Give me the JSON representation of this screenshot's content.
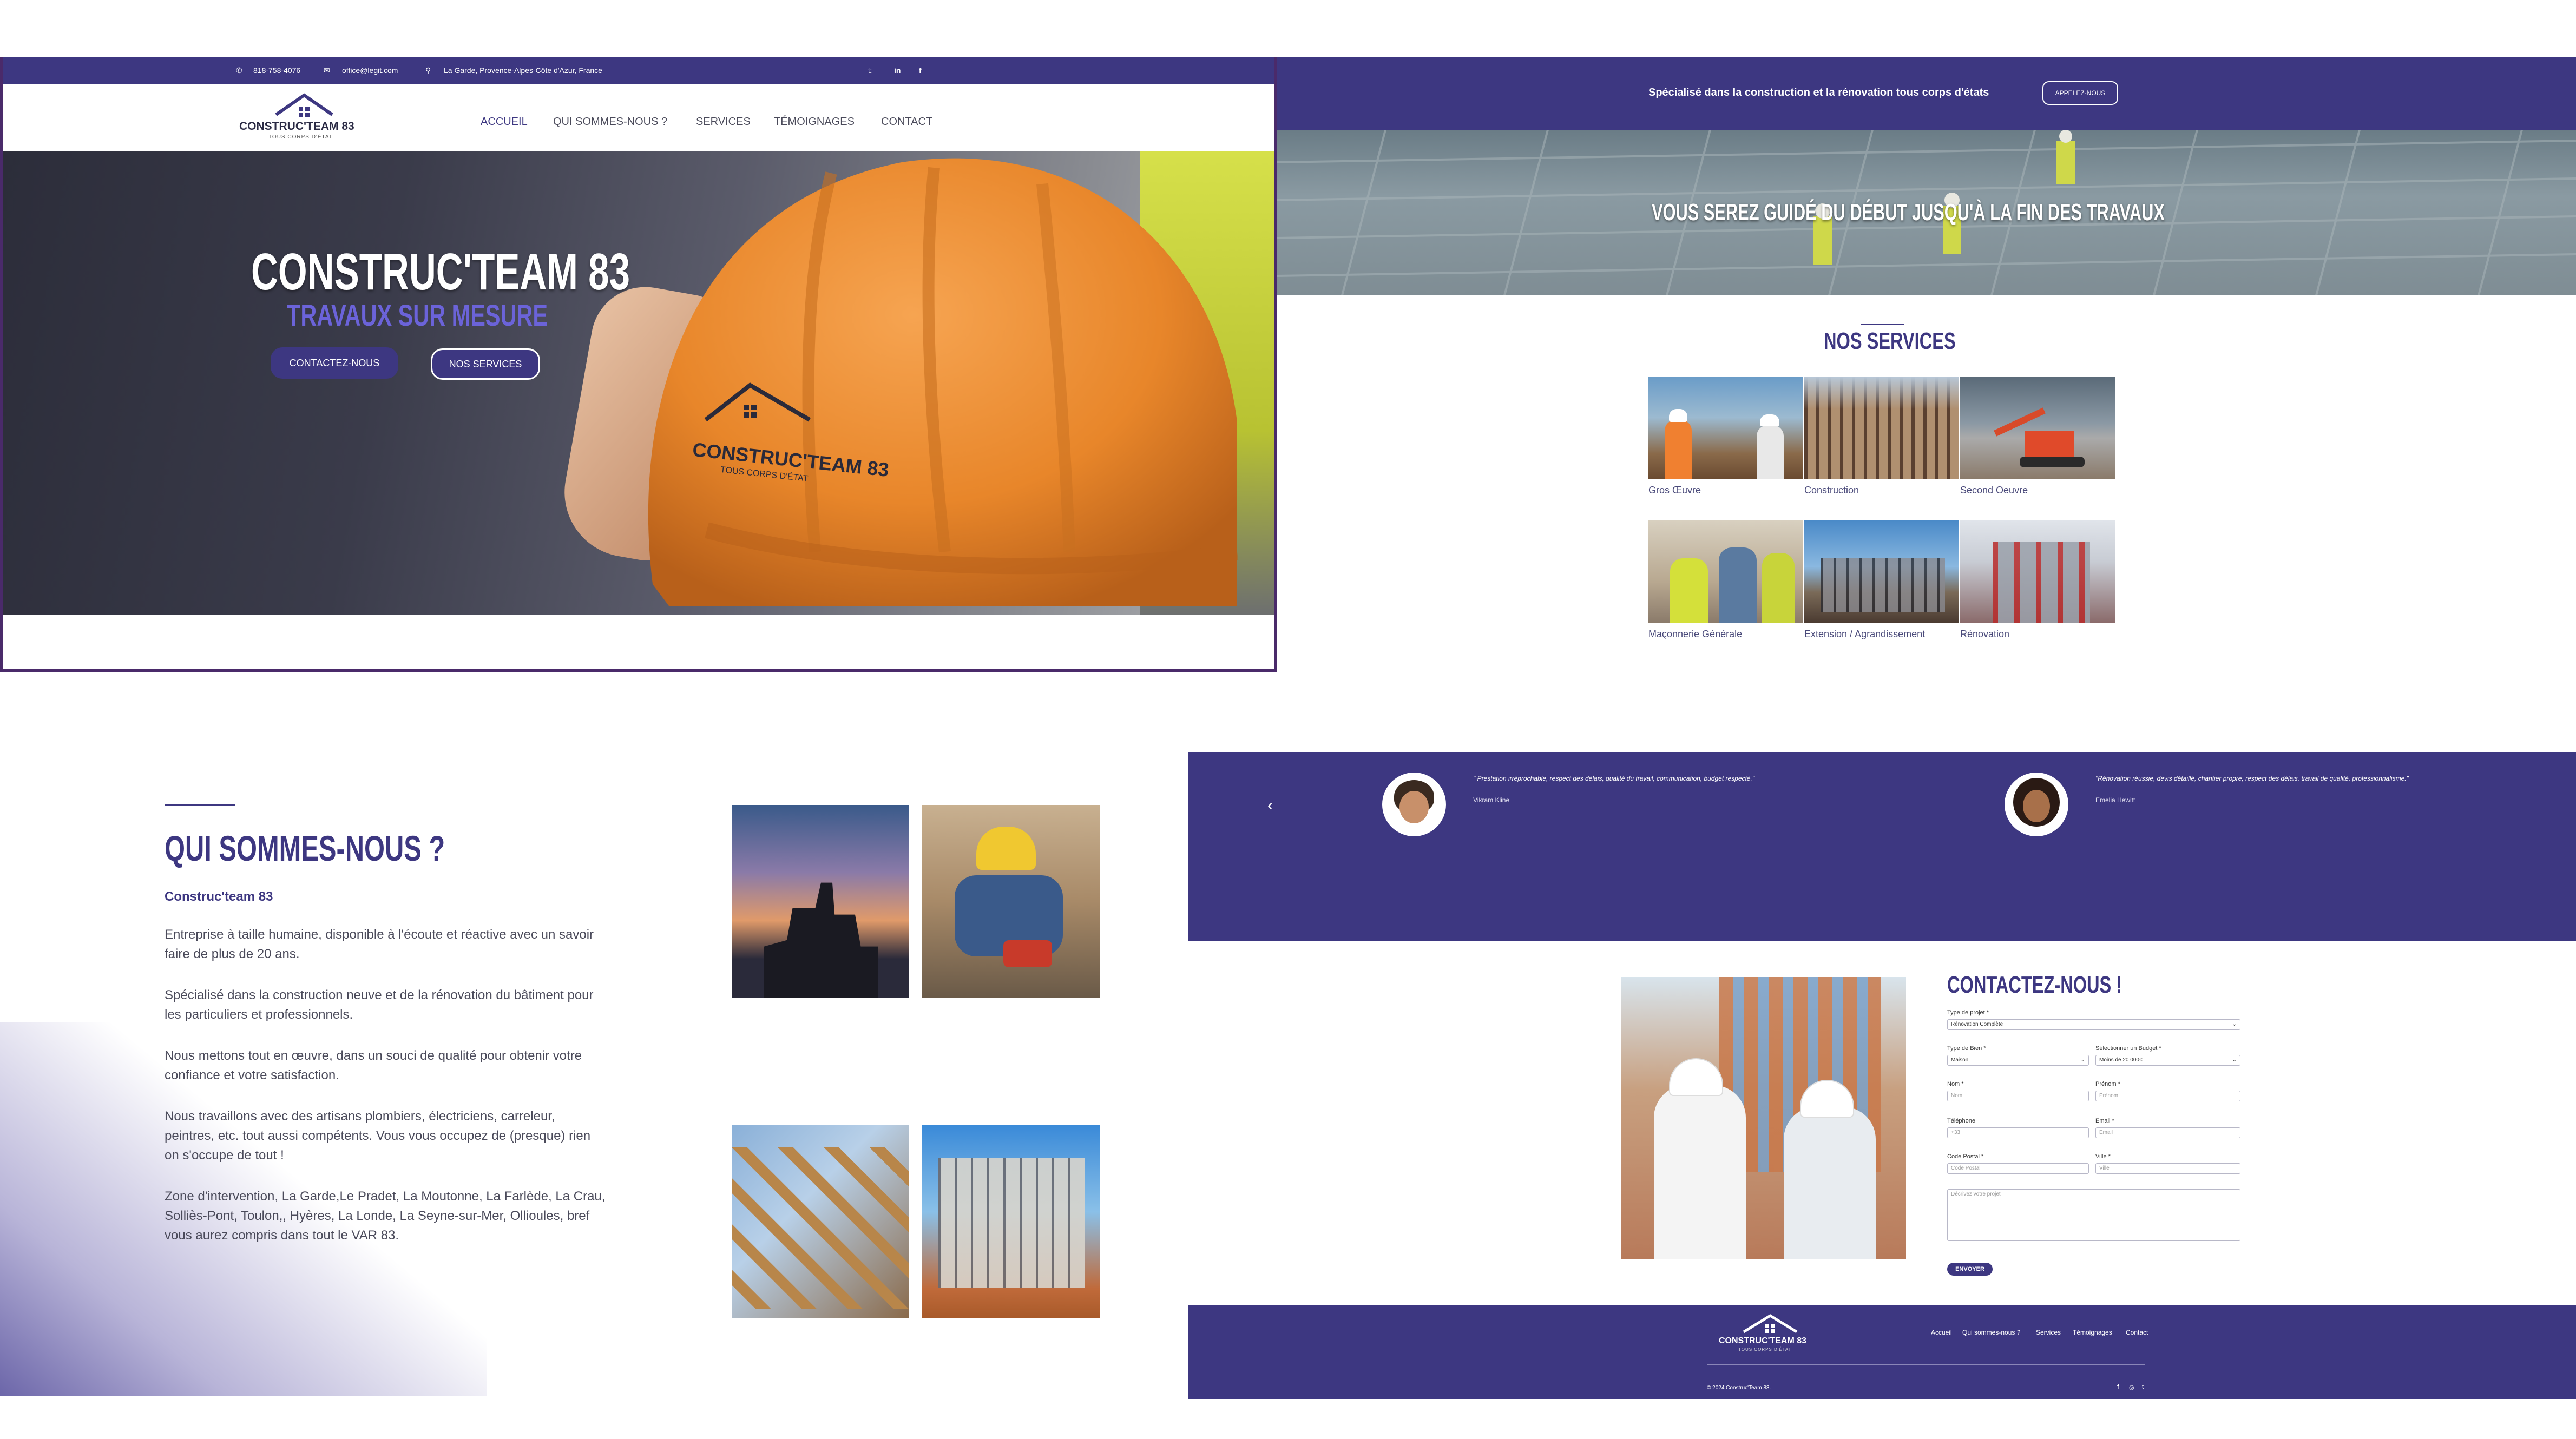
{
  "panel1": {
    "topbar": {
      "phone": "818-758-4076",
      "email": "office@legit.com",
      "address": "La Garde, Provence-Alpes-Côte d'Azur, France"
    },
    "logo": {
      "name": "CONSTRUC'TEAM 83",
      "tagline": "TOUS CORPS D'ÉTAT"
    },
    "nav": [
      "ACCUEIL",
      "QUI SOMMES-NOUS ?",
      "SERVICES",
      "TÉMOIGNAGES",
      "CONTACT"
    ],
    "hero": {
      "title": "CONSTRUC'TEAM 83",
      "subtitle": "TRAVAUX SUR MESURE",
      "btn_contact": "CONTACTEZ-NOUS",
      "btn_services": "NOS SERVICES"
    },
    "helmet_logo": {
      "name": "CONSTRUC'TEAM 83",
      "tagline": "TOUS CORPS D'ÉTAT"
    }
  },
  "panel2": {
    "band_text": "Spécialisé dans la construction et la rénovation tous corps d'états",
    "band_button": "APPELEZ-NOUS",
    "photo_heading": "VOUS SEREZ GUIDÉ DU DÉBUT JUSQU'À LA FIN DES TRAVAUX",
    "services_title": "NOS SERVICES",
    "services": [
      "Gros Œuvre",
      "Construction",
      "Second Oeuvre",
      "Maçonnerie Générale",
      "Extension / Agrandissement",
      "Rénovation"
    ]
  },
  "panel3": {
    "title": "QUI SOMMES-NOUS ?",
    "company": "Construc'team 83",
    "paragraphs": [
      "Entreprise à taille humaine, disponible à l'écoute et réactive avec un savoir faire de plus de 20 ans.",
      "Spécialisé dans la construction neuve et de la rénovation du bâtiment pour les particuliers et professionnels.",
      "Nous mettons tout en œuvre, dans un souci de qualité pour obtenir votre confiance et votre satisfaction.",
      "Nous travaillons avec des artisans plombiers, électriciens, carreleur, peintres, etc. tout aussi compétents. Vous vous occupez de (presque) rien on s'occupe de tout !",
      "Zone d'intervention, La Garde,Le Pradet, La Moutonne, La Farlède, La Crau, Solliès-Pont, Toulon,, Hyères, La Londe, La Seyne-sur-Mer, Ollioules, bref vous aurez compris dans tout le VAR 83."
    ]
  },
  "panel4": {
    "testimonials": [
      {
        "quote": "\" Prestation irréprochable, respect des délais, qualité du travail, communication, budget respecté.\"",
        "author": "Vikram Kline"
      },
      {
        "quote": "\"Rénovation réussie, devis détaillé, chantier propre, respect des délais, travail de qualité, professionnalisme.\"",
        "author": "Emelia Hewitt"
      }
    ],
    "prev_arrow": "‹",
    "contact": {
      "title": "CONTACTEZ-NOUS !",
      "project_type_label": "Type de projet *",
      "project_type_value": "Rénovation Complète",
      "property_type_label": "Type de Bien *",
      "property_type_value": "Maison",
      "budget_label": "Sélectionner un Budget *",
      "budget_value": "Moins de 20 000€",
      "name_label": "Nom *",
      "name_placeholder": "Nom",
      "firstname_label": "Prénom *",
      "firstname_placeholder": "Prénom",
      "phone_label": "Téléphone",
      "phone_placeholder": "+33",
      "email_label": "Email *",
      "email_placeholder": "Email",
      "zip_label": "Code Postal *",
      "zip_placeholder": "Code Postal",
      "city_label": "Ville *",
      "city_placeholder": "Ville",
      "message_placeholder": "Décrivez votre projet",
      "submit": "ENVOYER"
    },
    "footer": {
      "logo_name": "CONSTRUC'TEAM 83",
      "logo_tagline": "TOUS CORPS D'ÉTAT",
      "links": [
        "Accueil",
        "Qui sommes-nous ?",
        "Services",
        "Témoignages",
        "Contact"
      ],
      "copyright": "© 2024 Construc'Team 83.",
      "social": [
        "f",
        "◎",
        "t"
      ]
    }
  },
  "colors": {
    "brand": "#3d3781",
    "accent": "#6b63d9",
    "helmet": "#e8892c"
  }
}
